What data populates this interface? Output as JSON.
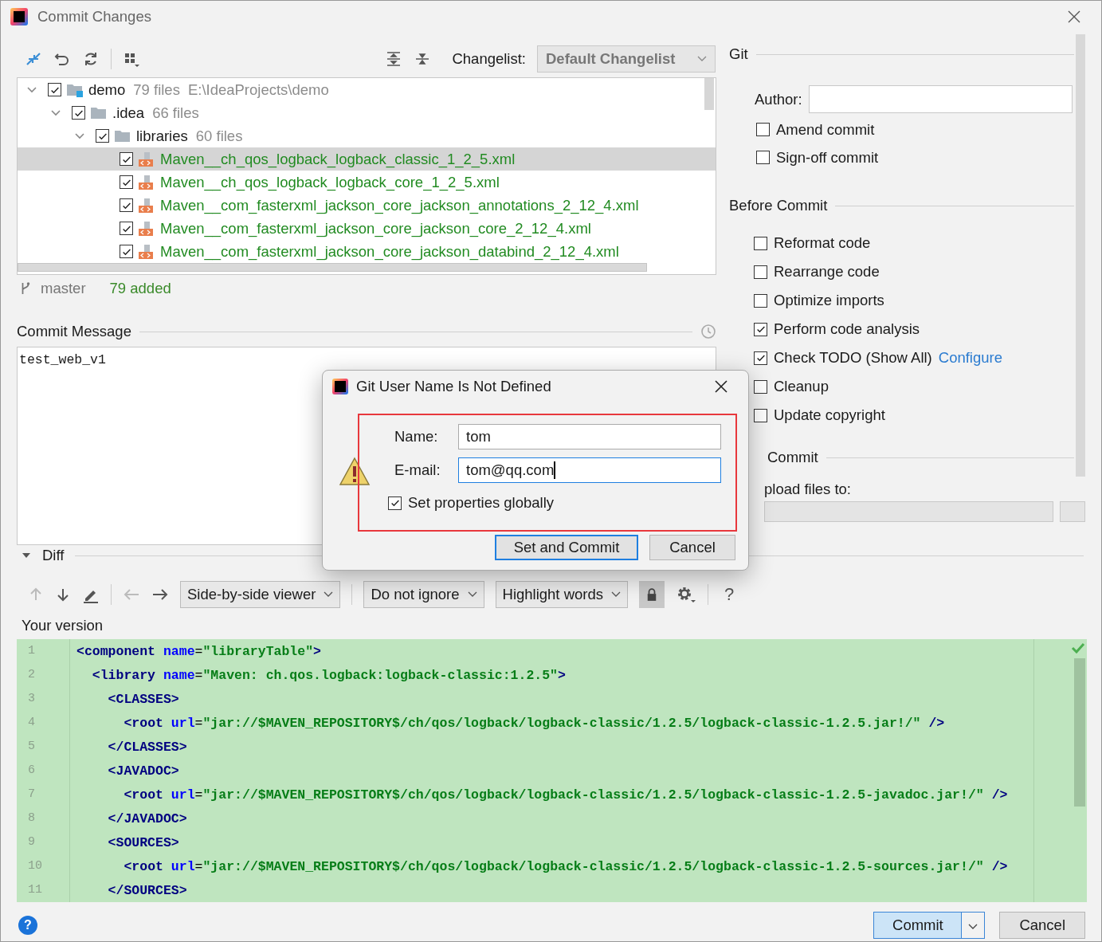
{
  "window": {
    "title": "Commit Changes"
  },
  "toolbar": {
    "changelist_label": "Changelist:",
    "changelist": "Default Changelist"
  },
  "tree": [
    {
      "name": "demo",
      "meta": "79 files",
      "path": "E:\\IdeaProjects\\demo",
      "kind": "module",
      "checked": true,
      "expanded": true,
      "selected": false,
      "children": [
        {
          "name": ".idea",
          "meta": "66 files",
          "kind": "folder",
          "checked": true,
          "expanded": true,
          "selected": false,
          "children": [
            {
              "name": "libraries",
              "meta": "60 files",
              "kind": "folder",
              "checked": true,
              "expanded": true,
              "selected": false,
              "children": [
                {
                  "name": "Maven__ch_qos_logback_logback_classic_1_2_5.xml",
                  "kind": "file",
                  "checked": true,
                  "selected": true
                },
                {
                  "name": "Maven__ch_qos_logback_logback_core_1_2_5.xml",
                  "kind": "file",
                  "checked": true,
                  "selected": false
                },
                {
                  "name": "Maven__com_fasterxml_jackson_core_jackson_annotations_2_12_4.xml",
                  "kind": "file",
                  "checked": true,
                  "selected": false
                },
                {
                  "name": "Maven__com_fasterxml_jackson_core_jackson_core_2_12_4.xml",
                  "kind": "file",
                  "checked": true,
                  "selected": false
                },
                {
                  "name": "Maven__com_fasterxml_jackson_core_jackson_databind_2_12_4.xml",
                  "kind": "file",
                  "checked": true,
                  "selected": false
                }
              ]
            }
          ]
        }
      ]
    }
  ],
  "status": {
    "branch": "master",
    "summary": "79 added"
  },
  "commit_message": {
    "label": "Commit Message",
    "value": "test_web_v1"
  },
  "git": {
    "title": "Git",
    "author_label": "Author:",
    "options": [
      {
        "label": "Amend commit",
        "checked": false
      },
      {
        "label": "Sign-off commit",
        "checked": false
      }
    ]
  },
  "before_commit": {
    "title": "Before Commit",
    "options": [
      {
        "label": "Reformat code",
        "checked": false
      },
      {
        "label": "Rearrange code",
        "checked": false
      },
      {
        "label": "Optimize imports",
        "checked": false
      },
      {
        "label": "Perform code analysis",
        "checked": true
      },
      {
        "label": "Check TODO (Show All)",
        "checked": true,
        "link": "Configure"
      },
      {
        "label": "Cleanup",
        "checked": false
      },
      {
        "label": "Update copyright",
        "checked": false
      }
    ]
  },
  "after_commit": {
    "title": "Commit",
    "upload_label": "pload files to:"
  },
  "diff": {
    "title": "Diff",
    "expanded": true,
    "viewer": "Side-by-side viewer",
    "ignore": "Do not ignore",
    "highlight": "Highlight words",
    "help": "?",
    "version_label": "Your version",
    "lines": [
      {
        "number": "1",
        "code": "<component name=\"libraryTable\">"
      },
      {
        "number": "2",
        "code": "  <library name=\"Maven: ch.qos.logback:logback-classic:1.2.5\">"
      },
      {
        "number": "3",
        "code": "    <CLASSES>"
      },
      {
        "number": "4",
        "code": "      <root url=\"jar://$MAVEN_REPOSITORY$/ch/qos/logback/logback-classic/1.2.5/logback-classic-1.2.5.jar!/\" />"
      },
      {
        "number": "5",
        "code": "    </CLASSES>"
      },
      {
        "number": "6",
        "code": "    <JAVADOC>"
      },
      {
        "number": "7",
        "code": "      <root url=\"jar://$MAVEN_REPOSITORY$/ch/qos/logback/logback-classic/1.2.5/logback-classic-1.2.5-javadoc.jar!/\" />"
      },
      {
        "number": "8",
        "code": "    </JAVADOC>"
      },
      {
        "number": "9",
        "code": "    <SOURCES>"
      },
      {
        "number": "10",
        "code": "      <root url=\"jar://$MAVEN_REPOSITORY$/ch/qos/logback/logback-classic/1.2.5/logback-classic-1.2.5-sources.jar!/\" />"
      },
      {
        "number": "11",
        "code": "    </SOURCES>"
      }
    ]
  },
  "footer": {
    "help": "?",
    "commit": "Commit",
    "cancel": "Cancel"
  },
  "dialog": {
    "title": "Git User Name Is Not Defined",
    "name_label": "Name:",
    "name": "tom",
    "email_label": "E-mail:",
    "email": "tom@qq.com",
    "set_globally": {
      "label": "Set properties globally",
      "checked": true
    },
    "buttons": [
      "Set and Commit",
      "Cancel"
    ]
  }
}
